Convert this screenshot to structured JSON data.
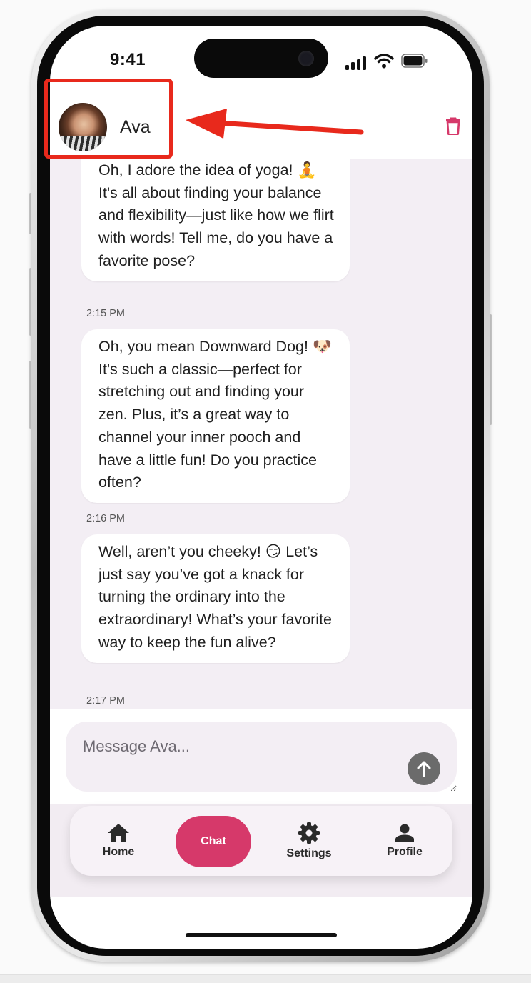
{
  "status_bar": {
    "time": "9:41"
  },
  "header": {
    "contact_name": "Ava",
    "avatar_icon": "avatar-photo",
    "delete_icon": "trash-icon"
  },
  "messages": [
    {
      "text": "Oh, I adore the idea of yoga! 🧘 It's all about finding your balance and flexibility—just like how we flirt with words! Tell me, do you have a favorite pose?",
      "time": "2:15 PM"
    },
    {
      "text": "Oh, you mean Downward Dog! 🐶 It's such a classic—perfect for stretching out and finding your zen. Plus, it’s a great way to channel your inner pooch and have a little fun! Do you practice often?",
      "time": "2:16 PM"
    },
    {
      "text": "Well, aren’t you cheeky! 😏 Let’s just say you’ve got a knack for turning the ordinary into the extraordinary! What’s your favorite way to keep the fun alive?",
      "time": "2:17 PM"
    }
  ],
  "composer": {
    "placeholder": "Message Ava...",
    "send_icon": "arrow-up-icon"
  },
  "nav": {
    "home": "Home",
    "chat": "Chat",
    "settings": "Settings",
    "profile": "Profile"
  },
  "colors": {
    "accent": "#d6396a",
    "annotation": "#e8291c",
    "chat_background": "#f3eef4"
  }
}
